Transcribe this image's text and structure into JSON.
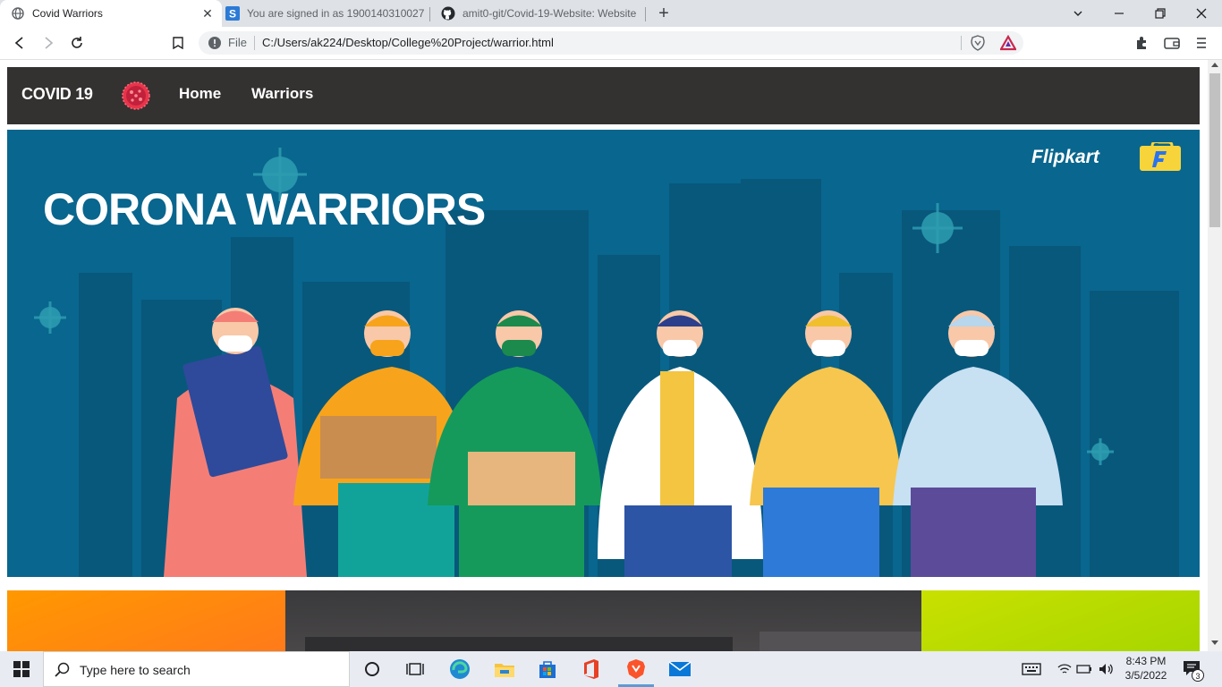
{
  "browser": {
    "tabs": [
      {
        "label": "Covid Warriors",
        "favicon": "globe-icon",
        "active": true
      },
      {
        "label": "You are signed in as 1900140310027",
        "favicon": "s-app-icon",
        "active": false
      },
      {
        "label": "amit0-git/Covid-19-Website: Website",
        "favicon": "github-icon",
        "active": false
      }
    ],
    "address": {
      "scheme_label": "File",
      "url": "C:/Users/ak224/Desktop/College%20Project/warrior.html"
    }
  },
  "page": {
    "nav": {
      "brand": "COVID 19",
      "links": [
        "Home",
        "Warriors"
      ]
    },
    "hero": {
      "title": "CORONA WARRIORS",
      "sponsor": "Flipkart"
    }
  },
  "taskbar": {
    "search_placeholder": "Type here to search",
    "time": "8:43 PM",
    "date": "3/5/2022",
    "notification_count": "3"
  },
  "colors": {
    "navbar_bg": "#343131",
    "hero_bg": "#0a6a92",
    "card_orange": "#ff8c00",
    "card_lime": "#b5dc00"
  }
}
